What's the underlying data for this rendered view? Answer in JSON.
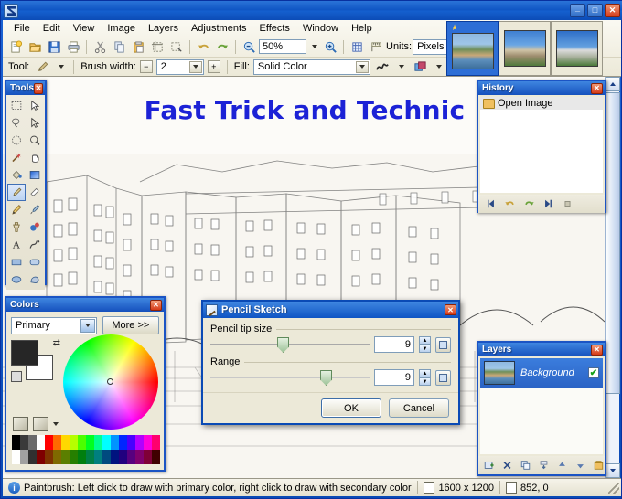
{
  "window": {
    "title": "",
    "icon": "paintdotnet-icon",
    "buttons": {
      "minimize": "_",
      "maximize": "□",
      "close": "✕"
    }
  },
  "menubar": {
    "items": [
      {
        "label": "File"
      },
      {
        "label": "Edit"
      },
      {
        "label": "View"
      },
      {
        "label": "Image"
      },
      {
        "label": "Layers"
      },
      {
        "label": "Adjustments"
      },
      {
        "label": "Effects"
      },
      {
        "label": "Window"
      },
      {
        "label": "Help"
      }
    ]
  },
  "toolbar_main": {
    "buttons": [
      {
        "name": "new-icon"
      },
      {
        "name": "open-icon"
      },
      {
        "name": "save-icon"
      },
      {
        "name": "print-icon"
      },
      {
        "name": "cut-icon"
      },
      {
        "name": "copy-icon"
      },
      {
        "name": "paste-icon"
      },
      {
        "name": "crop-to-selection-icon"
      },
      {
        "name": "deselect-icon"
      },
      {
        "name": "undo-icon"
      },
      {
        "name": "redo-icon"
      }
    ],
    "zoom_out_icon": "zoom-out-icon",
    "zoom_value": "50%",
    "zoom_in_icon": "zoom-in-icon",
    "grid_icon": "grid-icon",
    "rulers_icon": "rulers-icon",
    "units_label": "Units:",
    "units_value": "Pixels",
    "overflow_icon": "toolbar-overflow-icon"
  },
  "toolbar_tool": {
    "tool_label": "Tool:",
    "tool_icon": "paintbrush-icon",
    "brush_width_label": "Brush width:",
    "brush_width_value": "2",
    "brush_minus": "−",
    "brush_plus": "+",
    "fill_label": "Fill:",
    "fill_value": "Solid Color",
    "antialias_icon": "antialiasing-icon",
    "blend_icon": "blend-mode-icon"
  },
  "thumbnails": [
    {
      "name": "thumb-ponte-vecchio",
      "selected": true,
      "modified": true
    },
    {
      "name": "thumb-church-square",
      "selected": false,
      "modified": false
    },
    {
      "name": "thumb-tower",
      "selected": false,
      "modified": false
    }
  ],
  "canvas": {
    "overlay_title": "Fast Trick and Technic",
    "title_color": "#1c22d6",
    "background": "#f7f5f0"
  },
  "tools_palette": {
    "title": "Tools",
    "close": "✕",
    "tools": [
      {
        "name": "rectangle-select-icon",
        "active": false
      },
      {
        "name": "move-selected-icon",
        "active": false
      },
      {
        "name": "lasso-select-icon",
        "active": false
      },
      {
        "name": "move-selection-icon",
        "active": false
      },
      {
        "name": "ellipse-select-icon",
        "active": false
      },
      {
        "name": "zoom-icon",
        "active": false
      },
      {
        "name": "magic-wand-icon",
        "active": false
      },
      {
        "name": "pan-icon",
        "active": false
      },
      {
        "name": "paint-bucket-icon",
        "active": false
      },
      {
        "name": "gradient-icon",
        "active": false
      },
      {
        "name": "paintbrush-icon",
        "active": true
      },
      {
        "name": "eraser-icon",
        "active": false
      },
      {
        "name": "pencil-icon",
        "active": false
      },
      {
        "name": "color-picker-icon",
        "active": false
      },
      {
        "name": "clone-stamp-icon",
        "active": false
      },
      {
        "name": "recolor-icon",
        "active": false
      },
      {
        "name": "text-icon",
        "active": false
      },
      {
        "name": "line-curve-icon",
        "active": false
      },
      {
        "name": "rectangle-icon",
        "active": false
      },
      {
        "name": "rounded-rectangle-icon",
        "active": false
      },
      {
        "name": "ellipse-icon",
        "active": false
      },
      {
        "name": "freeform-shape-icon",
        "active": false
      }
    ]
  },
  "colors_palette": {
    "title": "Colors",
    "close": "✕",
    "mode_value": "Primary",
    "more_label": "More >>",
    "primary_color": "#262626",
    "secondary_color": "#ffffff",
    "swap_icon": "swap-colors-icon",
    "reset_icon": "reset-colors-icon",
    "screen_color_icon": "screen-color-icon",
    "palette_icon": "palette-icon",
    "palette_swatches_row1": [
      "#000000",
      "#404040",
      "#606060",
      "#ffffff",
      "#ff0000",
      "#ff6a00",
      "#ffd800",
      "#b6ff00",
      "#4cff00",
      "#00ff21",
      "#00ff90",
      "#00ffff",
      "#0094ff",
      "#0026ff",
      "#4800ff",
      "#b200ff",
      "#ff00dc",
      "#ff006e"
    ],
    "palette_swatches_row2": [
      "#ffffff",
      "#a0a0a0",
      "#303030",
      "#7f0000",
      "#7f3300",
      "#7f6a00",
      "#5b7f00",
      "#267f00",
      "#007f0e",
      "#007f46",
      "#007f7f",
      "#004a7f",
      "#00137f",
      "#21007f",
      "#57007f",
      "#7f006e",
      "#7f0037",
      "#3f0000"
    ]
  },
  "history_palette": {
    "title": "History",
    "close": "✕",
    "items": [
      {
        "label": "Open Image",
        "icon": "open-image-icon",
        "selected": true
      }
    ],
    "buttons": [
      {
        "name": "rewind-icon",
        "glyph": "⏮"
      },
      {
        "name": "undo-icon",
        "glyph": "↶"
      },
      {
        "name": "redo-icon",
        "glyph": "↷"
      },
      {
        "name": "fast-forward-icon",
        "glyph": "⏭"
      },
      {
        "name": "clear-history-icon",
        "glyph": "▫"
      }
    ]
  },
  "layers_palette": {
    "title": "Layers",
    "close": "✕",
    "layers": [
      {
        "name": "Background",
        "visible": true,
        "check": "✔",
        "selected": true
      }
    ],
    "buttons": [
      {
        "name": "add-layer-icon"
      },
      {
        "name": "delete-layer-icon"
      },
      {
        "name": "duplicate-layer-icon"
      },
      {
        "name": "merge-layer-down-icon"
      },
      {
        "name": "move-layer-up-icon"
      },
      {
        "name": "move-layer-down-icon"
      },
      {
        "name": "layer-properties-icon"
      }
    ]
  },
  "dialog": {
    "title": "Pencil Sketch",
    "icon": "pencil-sketch-icon",
    "close": "✕",
    "fields": [
      {
        "label": "Pencil tip size",
        "value": "9",
        "slider_percent": 42,
        "spin_up": "▲",
        "spin_down": "▼",
        "reset_icon": "reset-value-icon"
      },
      {
        "label": "Range",
        "value": "9",
        "slider_percent": 69,
        "spin_up": "▲",
        "spin_down": "▼",
        "reset_icon": "reset-value-icon"
      }
    ],
    "ok_label": "OK",
    "cancel_label": "Cancel"
  },
  "scrollbar": {
    "up_glyph": "▲",
    "down_glyph": "▼"
  },
  "statusbar": {
    "hint_icon": "info-icon",
    "hint": "Paintbrush: Left click to draw with primary color, right click to draw with secondary color",
    "size_icon": "image-size-icon",
    "image_size": "1600 x 1200",
    "position_icon": "cursor-position-icon",
    "cursor_position": "852, 0"
  }
}
